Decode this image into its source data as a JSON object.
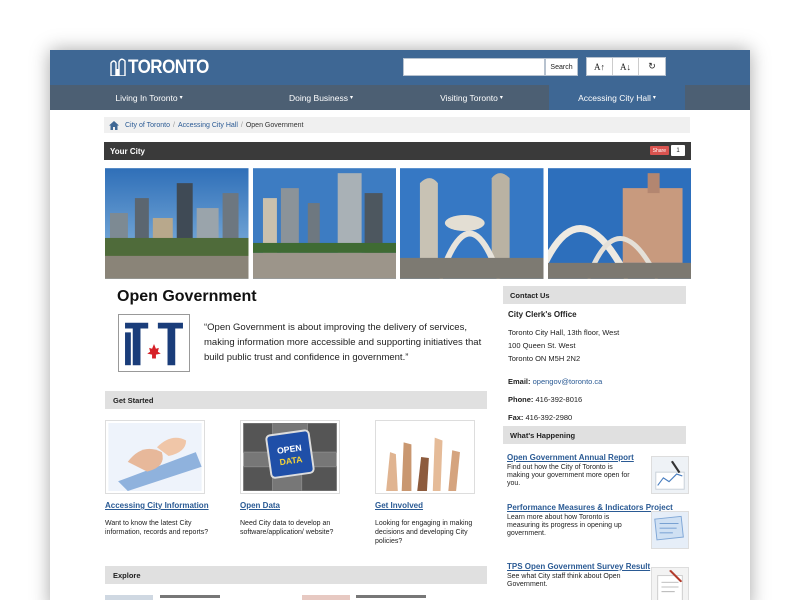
{
  "header": {
    "logo_text": "TORONTO",
    "search": {
      "placeholder": "",
      "button_label": "Search"
    },
    "font_controls": [
      "A↑",
      "A↓",
      "↻"
    ]
  },
  "nav": {
    "items": [
      {
        "label": "Living In Toronto",
        "caret": "▾",
        "active": false
      },
      {
        "label": "Doing Business",
        "caret": "▾",
        "active": false
      },
      {
        "label": "Visiting Toronto",
        "caret": "▾",
        "active": false
      },
      {
        "label": "Accessing City Hall",
        "caret": "▾",
        "active": true
      }
    ]
  },
  "breadcrumb": {
    "items": [
      "City of Toronto",
      "Accessing City Hall"
    ],
    "current": "Open Government",
    "separator": "/"
  },
  "your_city": {
    "title": "Your City",
    "share_label": "Share",
    "share_count": "1"
  },
  "main": {
    "title": "Open Government",
    "quote": "“Open Government is about improving the delivery of services, making information more accessible and supporting initiatives that build public trust and confidence in government.”",
    "get_started": {
      "heading": "Get Started"
    },
    "cards": [
      {
        "title": "Accessing City Information",
        "desc": "Want to know the latest City information, records and reports?"
      },
      {
        "title": "Open Data",
        "desc": "Need City data to develop an software/application/ website?",
        "image_text": [
          "OPEN",
          "DATA"
        ]
      },
      {
        "title": "Get Involved",
        "desc": "Looking for engaging in making decisions and developing City policies?"
      }
    ],
    "explore": {
      "heading": "Explore"
    }
  },
  "sidebar": {
    "contact": {
      "heading": "Contact Us",
      "office": "City Clerk's Office",
      "address": [
        "Toronto City Hall, 13th floor, West",
        "100 Queen St. West",
        "Toronto ON M5H 2N2"
      ],
      "email_label": "Email:",
      "email": "opengov@toronto.ca",
      "phone_label": "Phone:",
      "phone": "416-392-8016",
      "fax_label": "Fax:",
      "fax": "416-392-2980"
    },
    "whats_happening": {
      "heading": "What's Happening",
      "items": [
        {
          "title": "Open Government Annual Report",
          "desc": "Find out how the City of Toronto is making your government more open for you."
        },
        {
          "title": "Performance Measures & Indicators Project",
          "desc": "Learn more about how Toronto is measuring its progress in opening up government."
        },
        {
          "title": "TPS Open Government Survey Result",
          "desc": "See what City staff think about Open Government."
        }
      ]
    }
  },
  "colors": {
    "header_blue": "#3e6794",
    "nav_gray": "#4c5f73",
    "link_blue": "#2a5a94",
    "your_city_bar": "#3a3a3a",
    "section_bar": "#e0e0e0",
    "logo_red": "#d62027",
    "logo_navy": "#1a3d7a"
  }
}
